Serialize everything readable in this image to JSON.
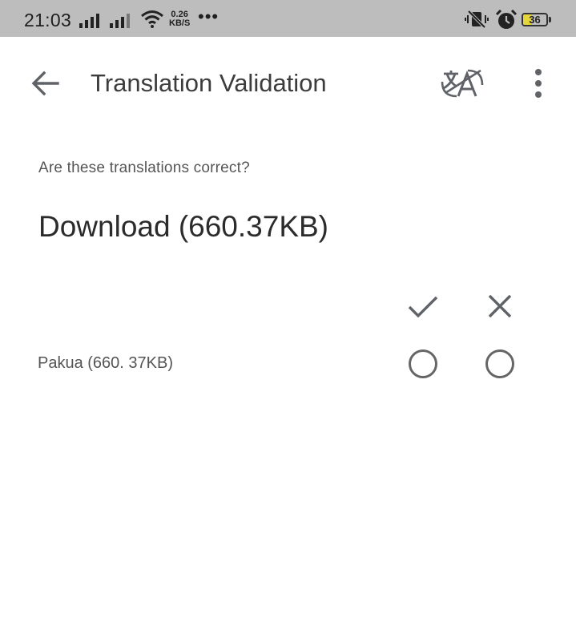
{
  "status_bar": {
    "time": "21:03",
    "network_speed_value": "0.26",
    "network_speed_unit": "KB/S",
    "more_indicator": "•••",
    "battery_level": "36",
    "icons": [
      "signal-icon",
      "signal-icon",
      "wifi-icon",
      "vibrate-off-icon",
      "alarm-icon",
      "battery-icon"
    ],
    "battery_color": "#e5d63c"
  },
  "app_bar": {
    "title": "Translation Validation",
    "icons": [
      "back-arrow-icon",
      "translate-icon",
      "more-vert-icon"
    ]
  },
  "main": {
    "prompt": "Are these translations correct?",
    "source_text": "Download (660.37KB)",
    "column_icons": [
      "check-icon",
      "close-icon"
    ],
    "translations": [
      {
        "text": "Pakua (660. 37KB)",
        "correct_selected": false,
        "incorrect_selected": false
      }
    ]
  },
  "colors": {
    "status_bar_bg": "#bdbdbd",
    "icon_gray": "#5f6368",
    "text_dark": "#2b2b2b",
    "text_muted": "#555555"
  }
}
